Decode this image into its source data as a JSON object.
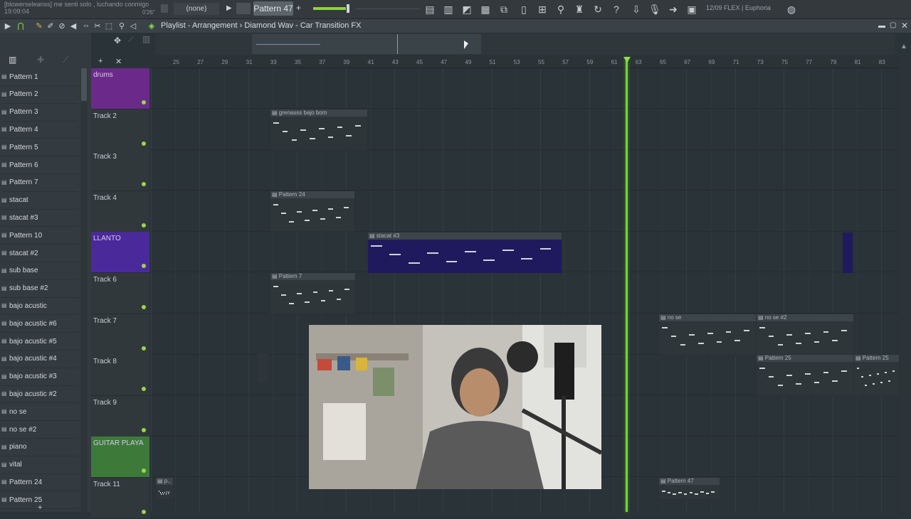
{
  "toolbar": {
    "hint_line1": "[blowerseleanss] me senti solo , luchando conmigo",
    "hint_line2": "19:09:04",
    "song_time": "0'26\"",
    "pattern_none": "(none)",
    "pattern_selected": "Pattern 47",
    "cpu_label": "12/09  FLEX | Euphoria"
  },
  "playlist": {
    "title": "Playlist - Arrangement",
    "separator": "›",
    "project": "Diamond Wav - Car Transition FX"
  },
  "patterns": [
    "Pattern 1",
    "Pattern 2",
    "Pattern 3",
    "Pattern 4",
    "Pattern 5",
    "Pattern 6",
    "Pattern 7",
    "stacat",
    "stacat #3",
    "Pattern 10",
    "stacat #2",
    "sub base",
    "sub base #2",
    "bajo acustic",
    "bajo acustic #6",
    "bajo acustic #5",
    "bajo acustic #4",
    "bajo acustic #3",
    "bajo acustic #2",
    "no se",
    "no se #2",
    "piano",
    "vital",
    "Pattern 24",
    "Pattern 25"
  ],
  "tracks": [
    {
      "name": "drums",
      "color": "#6b2a8a"
    },
    {
      "name": "Track 2",
      "color": ""
    },
    {
      "name": "Track 3",
      "color": ""
    },
    {
      "name": "Track 4",
      "color": ""
    },
    {
      "name": "LLANTO",
      "color": "#4a2a9a"
    },
    {
      "name": "Track 6",
      "color": ""
    },
    {
      "name": "Track 7",
      "color": ""
    },
    {
      "name": "Track 8",
      "color": ""
    },
    {
      "name": "Track 9",
      "color": ""
    },
    {
      "name": "GUITAR PLAYA",
      "color": "#3d7a3a"
    },
    {
      "name": "Track 11",
      "color": ""
    }
  ],
  "ruler_ticks": [
    "25",
    "27",
    "29",
    "31",
    "33",
    "35",
    "37",
    "39",
    "41",
    "43",
    "45",
    "47",
    "49",
    "51",
    "53",
    "55",
    "57",
    "59",
    "61",
    "63",
    "65",
    "67",
    "69",
    "71",
    "73",
    "75",
    "77",
    "79",
    "81",
    "83"
  ],
  "clips": [
    {
      "title": "grenasss bajo bom"
    },
    {
      "title": "Pattern 24"
    },
    {
      "title": "stacat #3"
    },
    {
      "title": "Pattern 7"
    },
    {
      "title": "no se"
    },
    {
      "title": "no se #2"
    },
    {
      "title": "Pattern 25"
    },
    {
      "title": "Pattern 25"
    },
    {
      "title": "Pattern 47"
    },
    {
      "title": "p.."
    }
  ],
  "colors": {
    "accent": "#76d13a",
    "background": "#2a3338",
    "panel": "#343b40"
  }
}
